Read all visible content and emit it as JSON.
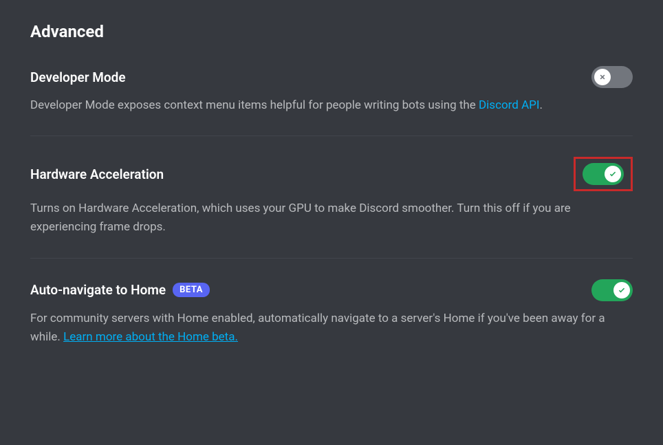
{
  "page": {
    "title": "Advanced"
  },
  "settings": {
    "developerMode": {
      "title": "Developer Mode",
      "descriptionPrefix": "Developer Mode exposes context menu items helpful for people writing bots using the ",
      "linkText": "Discord API",
      "descriptionSuffix": ".",
      "enabled": false
    },
    "hardwareAcceleration": {
      "title": "Hardware Acceleration",
      "description": "Turns on Hardware Acceleration, which uses your GPU to make Discord smoother. Turn this off if you are experiencing frame drops.",
      "enabled": true,
      "highlighted": true
    },
    "autoNavigateHome": {
      "title": "Auto-navigate to Home",
      "badge": "BETA",
      "descriptionPrefix": "For community servers with Home enabled, automatically navigate to a server's Home if you've been away for a while. ",
      "linkText": "Learn more about the Home beta.",
      "enabled": true
    }
  }
}
